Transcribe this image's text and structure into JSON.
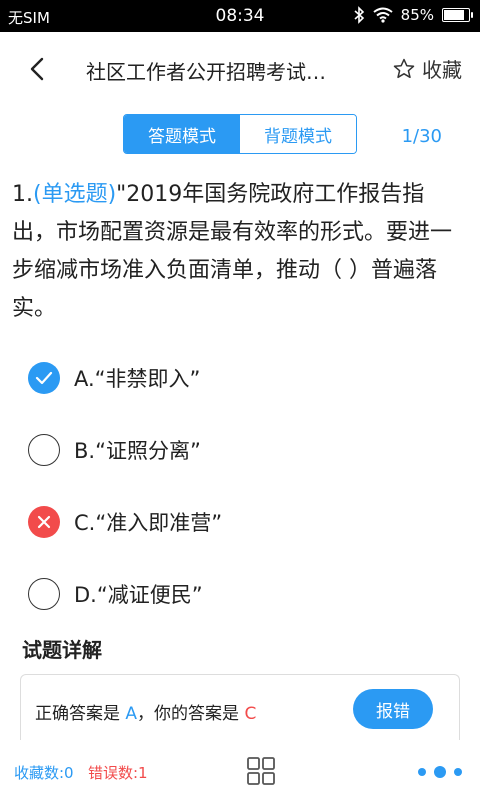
{
  "status_bar": {
    "carrier": "无SIM",
    "time": "08:34",
    "battery": "85%",
    "battery_level": 0.85
  },
  "header": {
    "title": "社区工作者公开招聘考试…",
    "favorite_label": "收藏"
  },
  "mode_toggle": {
    "answer_mode": "答题模式",
    "review_mode": "背题模式",
    "active": "answer_mode"
  },
  "page_indicator": "1/30",
  "question": {
    "number": "1.",
    "type": "(单选题)",
    "text": "\"2019年国务院政府工作报告指出，市场配置资源是最有效率的形式。要进一步缩减市场准入负面清单，推动（ ）普遍落实。"
  },
  "options": [
    {
      "label": "A.“非禁即入”",
      "state": "correct"
    },
    {
      "label": "B.“证照分离”",
      "state": "empty"
    },
    {
      "label": "C.“准入即准营”",
      "state": "wrong"
    },
    {
      "label": "D.“减证便民”",
      "state": "empty"
    }
  ],
  "detail": {
    "title": "试题详解",
    "correct_prefix": "正确答案是 ",
    "correct_answer": "A",
    "separator": "，你的答案是 ",
    "user_answer": "C",
    "report_label": "报错"
  },
  "bottom_bar": {
    "favorites": "收藏数:0",
    "errors": "错误数:1"
  },
  "colors": {
    "accent": "#2b9af3",
    "error": "#f24b4b"
  }
}
